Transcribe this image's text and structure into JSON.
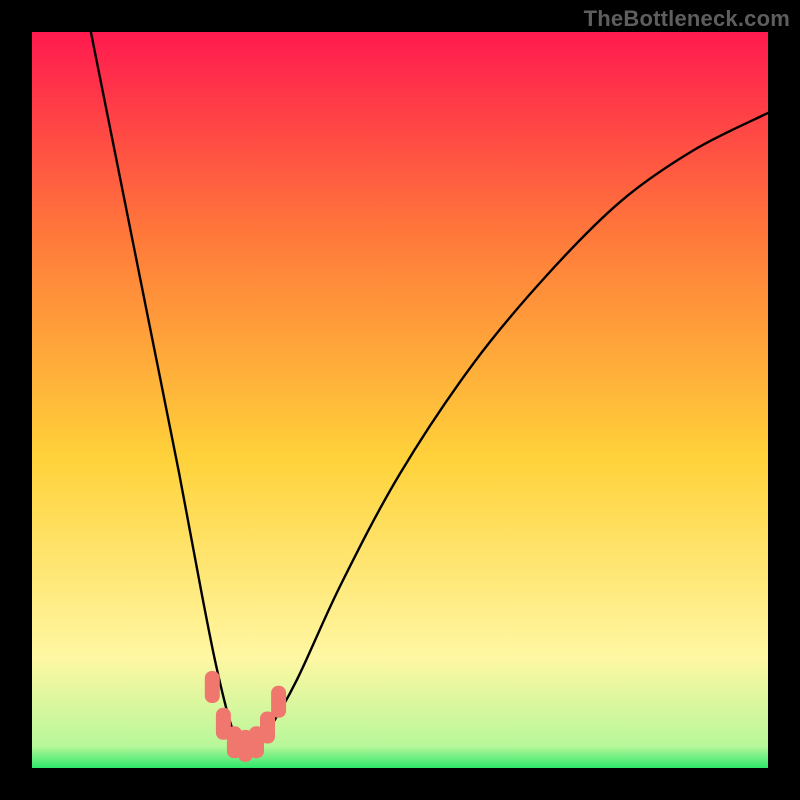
{
  "watermark": "TheBottleneck.com",
  "colors": {
    "frame": "#000000",
    "gradient_top": "#ff1a4f",
    "gradient_mid1": "#ff7a3a",
    "gradient_mid2": "#ffd23a",
    "gradient_low": "#fff7a3",
    "gradient_green": "#2ee86b",
    "curve": "#000000",
    "marker": "#f0776d"
  },
  "chart_data": {
    "type": "line",
    "title": "",
    "xlabel": "",
    "ylabel": "",
    "xlim": [
      0,
      100
    ],
    "ylim": [
      0,
      100
    ],
    "series": [
      {
        "name": "bottleneck-curve",
        "x": [
          8,
          12,
          16,
          20,
          23,
          25,
          27,
          28.5,
          30,
          32,
          36,
          42,
          50,
          60,
          70,
          80,
          90,
          100
        ],
        "values": [
          100,
          80,
          60,
          40,
          24,
          14,
          6,
          3,
          3,
          5,
          12,
          25,
          40,
          55,
          67,
          77,
          84,
          89
        ]
      }
    ],
    "markers": {
      "name": "highlight-band",
      "x": [
        24.5,
        26,
        27.5,
        29,
        30.5,
        32,
        33.5
      ],
      "values": [
        11,
        6,
        3.5,
        3,
        3.5,
        5.5,
        9
      ]
    },
    "annotations": []
  }
}
